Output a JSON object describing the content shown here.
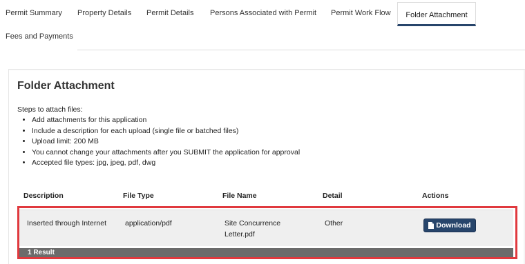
{
  "tabs": [
    {
      "label": "Permit Summary"
    },
    {
      "label": "Property Details"
    },
    {
      "label": "Permit Details"
    },
    {
      "label": "Persons Associated with Permit"
    },
    {
      "label": "Permit Work Flow"
    },
    {
      "label": "Folder Attachment",
      "active": true
    },
    {
      "label": "Fees and Payments"
    }
  ],
  "section": {
    "title": "Folder Attachment",
    "steps_label": "Steps to attach files:",
    "steps": [
      "Add attachments for this application",
      "Include a description for each upload (single file or batched files)",
      "Upload limit: 200 MB",
      "You cannot change your attachments after you SUBMIT the application for approval",
      "Accepted file types: jpg, jpeg, pdf, dwg"
    ]
  },
  "table": {
    "headers": [
      "Description",
      "File Type",
      "File Name",
      "Detail",
      "Actions"
    ],
    "rows": [
      {
        "description": "Inserted through Internet",
        "file_type": "application/pdf",
        "file_name": "Site Concurrence Letter.pdf",
        "detail": "Other",
        "action_label": "Download",
        "action_icon": "file-icon"
      }
    ],
    "result_text": "1 Result"
  },
  "colors": {
    "accent": "#27456b",
    "highlight_border": "#e0393e",
    "result_bar": "#6b6b6b"
  }
}
